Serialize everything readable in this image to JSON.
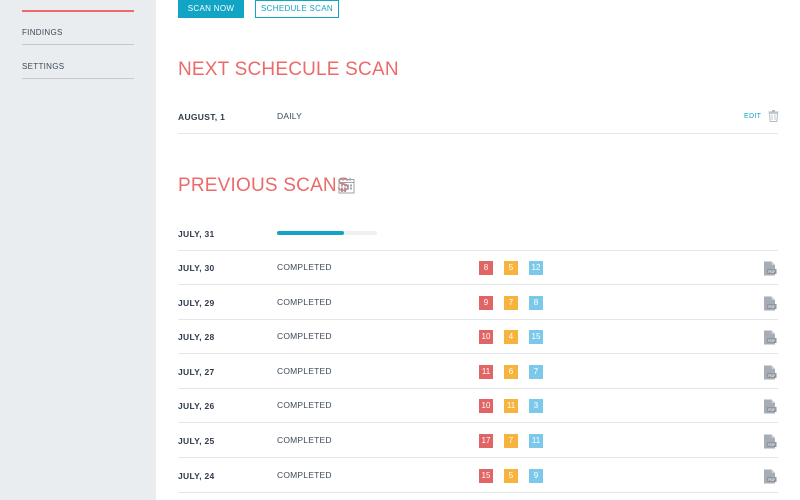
{
  "sidebar": {
    "items": [
      {
        "label": "FINDINGS"
      },
      {
        "label": "SETTINGS"
      }
    ]
  },
  "toolbar": {
    "scan_now_label": "SCAN NOW",
    "schedule_scan_label": "SCHEDULE SCAN"
  },
  "next_scan": {
    "title": "NEXT SCHECULE SCAN",
    "date": "AUGUST, 1",
    "frequency": "DAILY",
    "edit_label": "EDIT"
  },
  "previous_scans": {
    "title": "PREVIOUS SCANS",
    "in_progress": {
      "date": "JULY, 31",
      "progress": 0.67
    },
    "rows": [
      {
        "date": "JULY, 30",
        "status": "COMPLETED",
        "high": "8",
        "medium": "5",
        "low": "12"
      },
      {
        "date": "JULY, 29",
        "status": "COMPLETED",
        "high": "9",
        "medium": "7",
        "low": "8"
      },
      {
        "date": "JULY, 28",
        "status": "COMPLETED",
        "high": "10",
        "medium": "4",
        "low": "15"
      },
      {
        "date": "JULY, 27",
        "status": "COMPLETED",
        "high": "11",
        "medium": "6",
        "low": "7"
      },
      {
        "date": "JULY, 26",
        "status": "COMPLETED",
        "high": "10",
        "medium": "11",
        "low": "3"
      },
      {
        "date": "JULY, 25",
        "status": "COMPLETED",
        "high": "17",
        "medium": "7",
        "low": "11"
      },
      {
        "date": "JULY, 24",
        "status": "COMPLETED",
        "high": "15",
        "medium": "5",
        "low": "9"
      }
    ]
  },
  "colors": {
    "accent": "#12a4c4",
    "title": "#ec6a6a",
    "severity_high": "#e26565",
    "severity_medium": "#f6b33e",
    "severity_low": "#7cc8ea"
  },
  "icons": {
    "row_action": "pdf-file-icon",
    "section": "calendar-icon",
    "delete": "trash-icon"
  }
}
